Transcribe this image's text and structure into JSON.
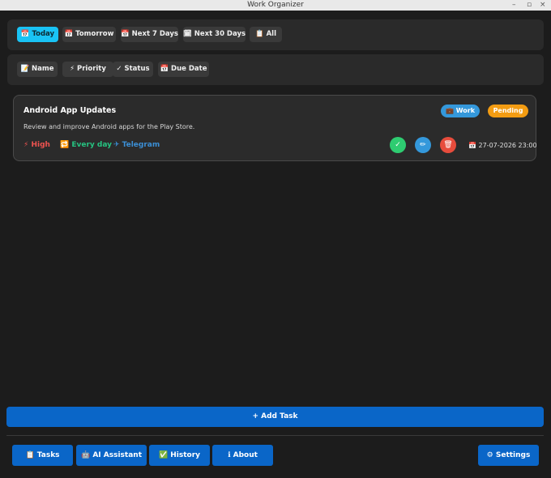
{
  "window": {
    "title": "Work Organizer"
  },
  "date_filters": [
    {
      "icon": "📅",
      "label": "Today",
      "active": true
    },
    {
      "icon": "📅",
      "label": "Tomorrow"
    },
    {
      "icon": "📅",
      "label": "Next 7 Days"
    },
    {
      "icon": "🗓",
      "label": "Next 30 Days"
    },
    {
      "icon": "📋",
      "label": "All"
    }
  ],
  "sort_options": [
    {
      "icon": "📝",
      "label": "Name"
    },
    {
      "icon": "⚡",
      "label": "Priority"
    },
    {
      "icon": "✓",
      "label": "Status"
    },
    {
      "icon": "📅",
      "label": "Due Date"
    }
  ],
  "task": {
    "title": "Android App Updates",
    "description": "Review and improve Android apps for the Play Store.",
    "category": "💼 Work",
    "status": "Pending",
    "priority": "⚡ High",
    "recurrence": "🔁 Every day",
    "channel": "✈ Telegram",
    "due": "📅 27-07-2026 23:00",
    "actions": {
      "complete": "✓",
      "edit": "✏",
      "delete": "🗑"
    }
  },
  "add_task_label": "+ Add Task",
  "nav": {
    "tasks": "📋 Tasks",
    "ai_assistant": "🤖 AI Assistant",
    "history": "✅ History",
    "about": "ℹ About",
    "settings": "⚙ Settings"
  },
  "colors": {
    "accent": "#19c3f5",
    "primary_button": "#0a66c8",
    "priority_high": "#ef5350",
    "recurrence": "#26c281",
    "channel": "#3b8fd6",
    "status_pending": "#f39c12",
    "category_work": "#3498db",
    "complete": "#2ecc71",
    "edit": "#3498db",
    "delete": "#e74c3c"
  }
}
